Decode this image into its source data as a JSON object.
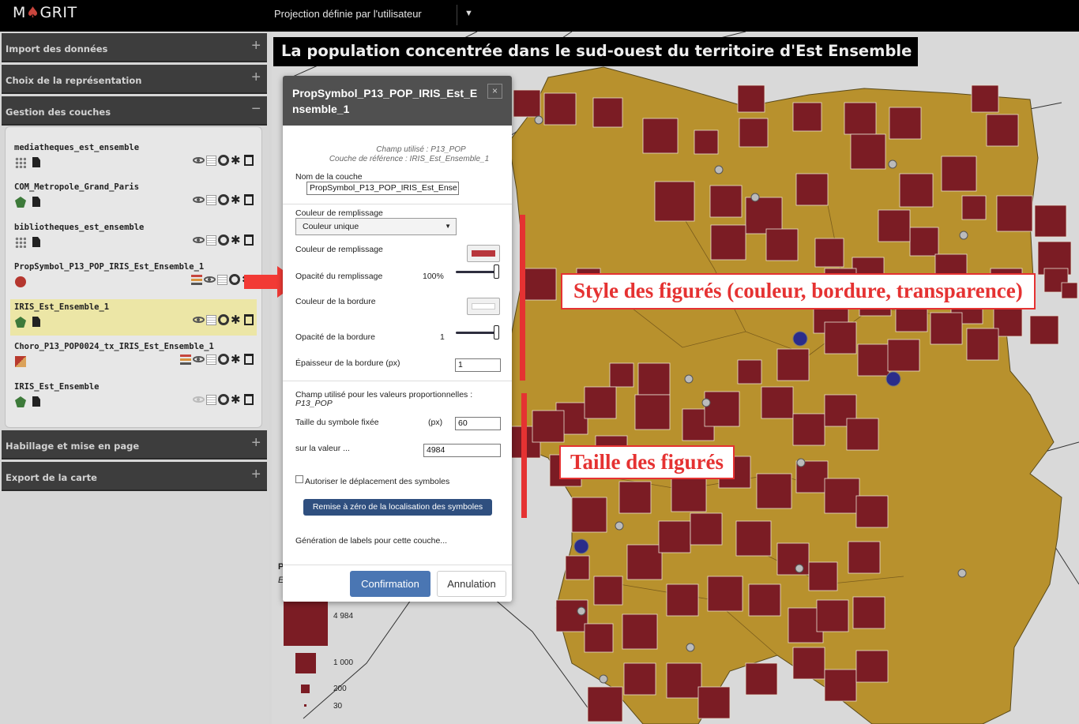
{
  "app": {
    "logo_text": "GRIT",
    "logo_first": "M",
    "projection_label": "Projection définie par l'utilisateur"
  },
  "sidebar": {
    "sections": [
      {
        "label": "Import des données"
      },
      {
        "label": "Choix de la représentation"
      },
      {
        "label": "Gestion des couches"
      },
      {
        "label": "Habillage et mise en page"
      },
      {
        "label": "Export de la carte"
      }
    ],
    "layers": [
      {
        "name": "mediatheques_est_ensemble"
      },
      {
        "name": "COM_Metropole_Grand_Paris"
      },
      {
        "name": "bibliotheques_est_ensemble"
      },
      {
        "name": "PropSymbol_P13_POP_IRIS_Est_Ensemble_1"
      },
      {
        "name": "IRIS_Est_Ensemble_1"
      },
      {
        "name": "Choro_P13_POP0024_tx_IRIS_Est_Ensemble_1"
      },
      {
        "name": "IRIS_Est_Ensemble"
      }
    ]
  },
  "map": {
    "title": "La population concentrée dans le sud-ouest du territoire d'Est Ensemble",
    "legend_values": [
      "4 984",
      "1 000",
      "200",
      "30"
    ],
    "legend_title_letter": "P",
    "legend_subtitle_letter": "E",
    "colors": {
      "territory": "#b8912d",
      "symbol": "#7b1c24",
      "background": "#d9d9d9",
      "marker": "#2a2c8a"
    }
  },
  "annotations": {
    "style": "Style des figurés (couleur, bordure, transparence)",
    "size": "Taille des figurés",
    "color": "#e53232"
  },
  "modal": {
    "title": "PropSymbol_P13_POP_IRIS_Est_Ensemble_1",
    "field_used": "Champ utilisé : P13_POP",
    "reference_layer": "Couche de référence : IRIS_Est_Ensemble_1",
    "layer_name_label": "Nom de la couche",
    "layer_name_value": "PropSymbol_P13_POP_IRIS_Est_Ense",
    "fill_color_mode_label": "Couleur de remplissage",
    "fill_color_mode_value": "Couleur unique",
    "fill_color_label": "Couleur de remplissage",
    "fill_color": "#b8363c",
    "fill_opacity_label": "Opacité du remplissage",
    "fill_opacity_value": "100%",
    "border_color_label": "Couleur de la bordure",
    "border_color": "#ffffff",
    "border_opacity_label": "Opacité de la bordure",
    "border_opacity_value": "1",
    "border_width_label": "Épaisseur de la bordure (px)",
    "border_width_value": "1",
    "prop_field_label": "Champ utilisé pour les valeurs proportionnelles :",
    "prop_field_value": "P13_POP",
    "fixed_size_label": "Taille du symbole fixée",
    "fixed_size_unit": "(px)",
    "fixed_size_value": "60",
    "on_value_label": "sur la valeur ...",
    "on_value_value": "4984",
    "allow_move_label": "Autoriser le déplacement des symboles",
    "reset_label": "Remise à zéro de la localisation des symboles",
    "labels_label": "Génération de labels pour cette couche...",
    "confirm_label": "Confirmation",
    "cancel_label": "Annulation",
    "close_label": "×"
  }
}
